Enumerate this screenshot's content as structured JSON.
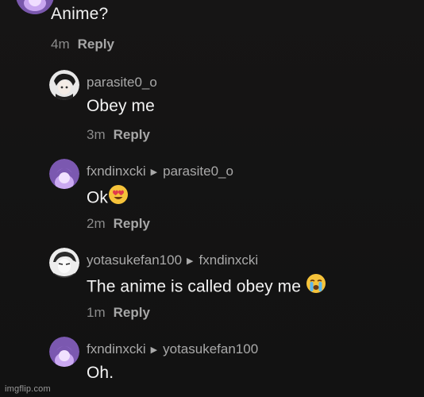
{
  "top_comment": {
    "text": "Anime?",
    "time": "4m",
    "reply_label": "Reply"
  },
  "replies": [
    {
      "username": "parasite0_o",
      "reply_to": "",
      "text": "Obey me",
      "emoji": "",
      "time": "3m",
      "reply_label": "Reply"
    },
    {
      "username": "fxndinxcki",
      "reply_to": "parasite0_o",
      "text": "Ok",
      "emoji": "heart-eyes-emoji",
      "time": "2m",
      "reply_label": "Reply"
    },
    {
      "username": "yotasukefan100",
      "reply_to": "fxndinxcki",
      "text": "The anime is called obey me ",
      "emoji": "crying-emoji",
      "time": "1m",
      "reply_label": "Reply"
    },
    {
      "username": "fxndinxcki",
      "reply_to": "yotasukefan100",
      "text": "Oh.",
      "emoji": "",
      "time": "",
      "reply_label": ""
    }
  ],
  "watermark": "imgflip.com",
  "colors": {
    "background": "#141414",
    "text_primary": "#f3f3f3",
    "text_secondary": "#a9a9a9",
    "meta": "#8b8b8b"
  }
}
